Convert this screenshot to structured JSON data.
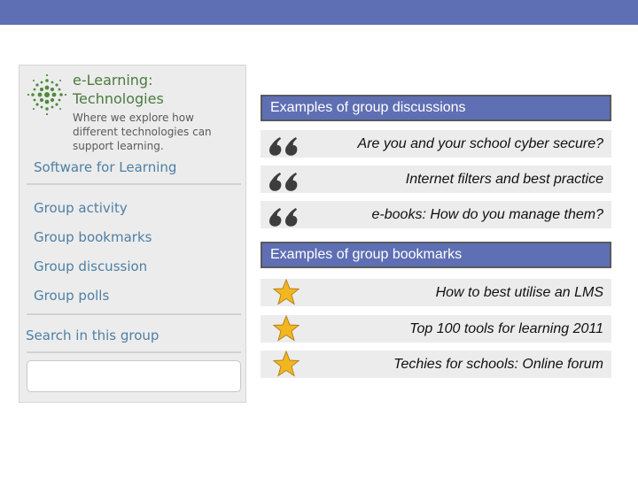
{
  "sidebar": {
    "brand": {
      "title_line1": "e-Learning:",
      "title_line2": "Technologies",
      "subtitle_line1": "Where we explore how",
      "subtitle_line2": "different technologies can",
      "subtitle_line3": "support learning."
    },
    "section_title": "Software for Learning",
    "links": [
      "Group activity",
      "Group bookmarks",
      "Group discussion",
      "Group polls"
    ],
    "search_heading": "Search in this group",
    "search_value": ""
  },
  "discussions": {
    "header": "Examples of group discussions",
    "items": [
      "Are you and your school cyber secure?",
      "Internet filters and best practice",
      "e-books: How do you manage them?"
    ]
  },
  "bookmarks": {
    "header": "Examples of group bookmarks",
    "items": [
      "How to best utilise an LMS",
      "Top 100 tools for learning 2011",
      "Techies for schools: Online forum"
    ]
  },
  "colors": {
    "accent_bar": "#5f6fb4",
    "panel_bg": "#ececec",
    "link": "#4d7fa5",
    "brand_green": "#4a7a3e",
    "star": "#f2b621"
  },
  "icons": {
    "logo": "globe-dots-logo-icon",
    "discussion": "quote-marks-icon",
    "bookmark": "star-icon"
  }
}
